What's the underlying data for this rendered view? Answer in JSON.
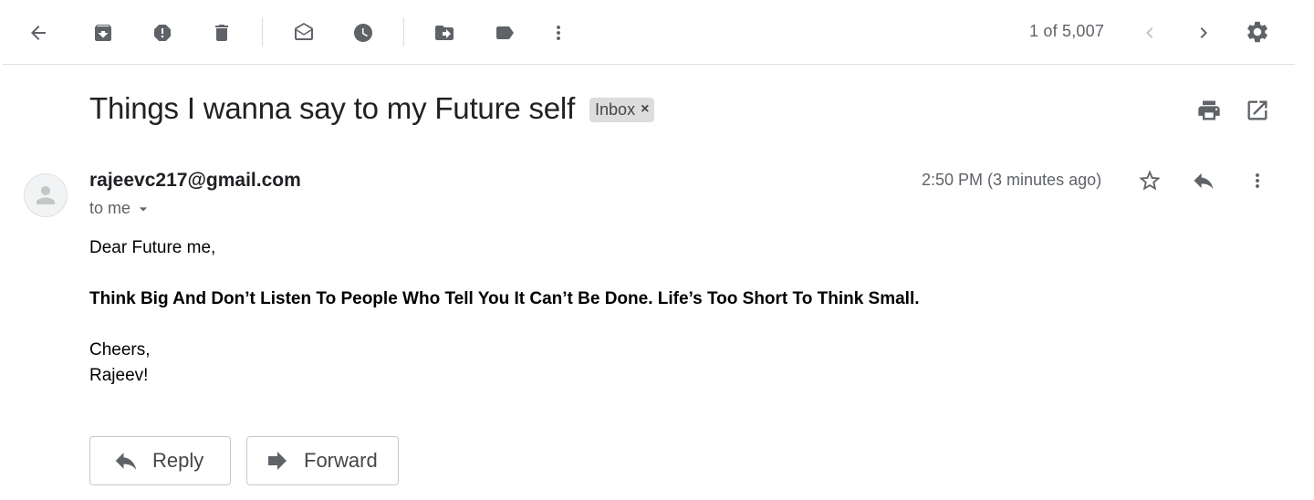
{
  "toolbar": {
    "icons": [
      "back-arrow-icon",
      "archive-icon",
      "report-spam-icon",
      "delete-icon",
      "mark-unread-icon",
      "snooze-icon",
      "move-to-icon",
      "label-icon",
      "more-vert-icon"
    ],
    "count": "1 of 5,007"
  },
  "message": {
    "subject": "Things I wanna say to my Future self",
    "label": "Inbox",
    "label_remove": "×",
    "sender": "rajeevc217@gmail.com",
    "recipient": "to me",
    "time": "2:50 PM (3 minutes ago)",
    "body": {
      "greeting": "Dear Future me,",
      "quote": "Think Big And Don’t Listen To People Who Tell You It Can’t Be Done. Life’s Too Short To Think Small.",
      "closing": "Cheers,",
      "signature": "Rajeev!"
    }
  },
  "actions": {
    "reply": "Reply",
    "forward": "Forward"
  }
}
